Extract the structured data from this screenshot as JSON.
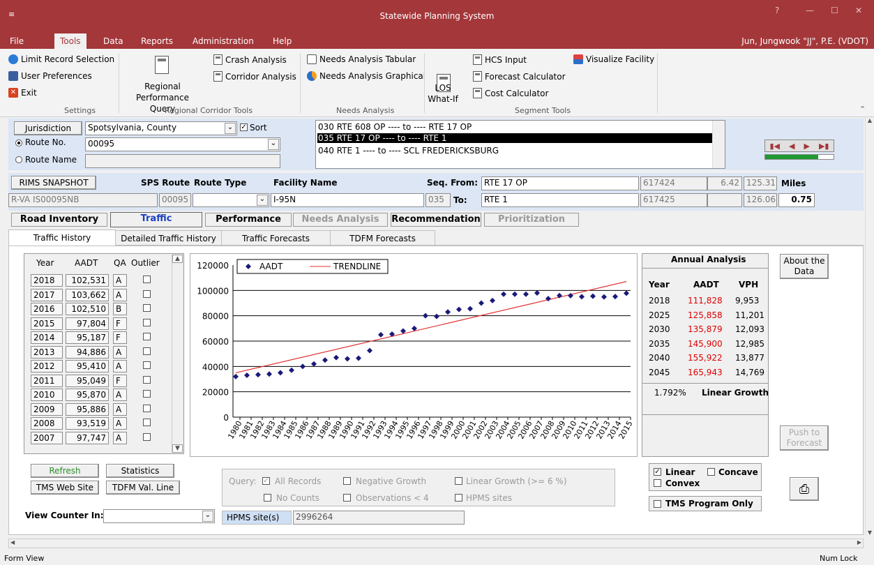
{
  "window": {
    "title": "Statewide Planning System",
    "qat_icon": "≡"
  },
  "menu": [
    "File",
    "Tools",
    "Data",
    "Reports",
    "Administration",
    "Help"
  ],
  "user": "Jun, Jungwook \"JJ\", P.E. (VDOT)",
  "ribbon": {
    "settings": {
      "items": [
        "Limit Record Selection",
        "User Preferences",
        "Exit"
      ],
      "label": "Settings"
    },
    "regional": {
      "big": "Regional Performance Query",
      "items": [
        "Crash Analysis",
        "Corridor Analysis"
      ],
      "label": "Regional Corridor Tools"
    },
    "needs": {
      "items": [
        "Needs Analysis Tabular",
        "Needs Analysis Graphical"
      ],
      "label": "Needs Analysis"
    },
    "segment": {
      "big": "LOS What-If",
      "items": [
        "HCS Input",
        "Forecast Calculator",
        "Cost Calculator"
      ],
      "label": "Segment Tools"
    },
    "visualize": "Visualize Facility"
  },
  "filter": {
    "jurisdiction_btn": "Jurisdiction",
    "jurisdiction": "Spotsylvania, County",
    "sort": "Sort",
    "route_no": "Route No.",
    "route_no_value": "00095",
    "route_name": "Route Name"
  },
  "segments": [
    "030  RTE 608 OP ---- to ---- RTE 17 OP",
    "035  RTE 17 OP ---- to ---- RTE 1",
    "040  RTE 1 ---- to ---- SCL FREDERICKSBURG"
  ],
  "header_row": {
    "rims": "RIMS SNAPSHOT",
    "sps_route": "SPS Route",
    "route_type": "Route Type",
    "facility_name": "Facility Name",
    "seq_from": "Seq. From:",
    "from_value": "RTE 17 OP",
    "id1": "617424",
    "m1": "6.42",
    "m2": "125.31",
    "miles": "Miles"
  },
  "value_row": {
    "rims_id": "R-VA   IS00095NB",
    "sps": "00095",
    "facility": "I-95N",
    "seq": "035",
    "to": "To:",
    "to_value": "RTE 1",
    "id2": "617425",
    "m3": "126.06",
    "miles_val": "0.75"
  },
  "main_tabs": [
    "Road Inventory",
    "Traffic",
    "Performance",
    "Needs Analysis",
    "Recommendation",
    "Prioritization"
  ],
  "sub_tabs": [
    "Traffic History",
    "Detailed Traffic History",
    "Traffic Forecasts",
    "TDFM Forecasts"
  ],
  "history": {
    "headers": [
      "Year",
      "AADT",
      "QA",
      "Outlier"
    ],
    "rows": [
      [
        "2018",
        "102,531",
        "A"
      ],
      [
        "2017",
        "103,662",
        "A"
      ],
      [
        "2016",
        "102,510",
        "B"
      ],
      [
        "2015",
        "97,804",
        "F"
      ],
      [
        "2014",
        "95,187",
        "F"
      ],
      [
        "2013",
        "94,886",
        "A"
      ],
      [
        "2012",
        "95,410",
        "A"
      ],
      [
        "2011",
        "95,049",
        "F"
      ],
      [
        "2010",
        "95,870",
        "A"
      ],
      [
        "2009",
        "95,886",
        "A"
      ],
      [
        "2008",
        "93,519",
        "A"
      ],
      [
        "2007",
        "97,747",
        "A"
      ]
    ]
  },
  "chart_data": {
    "type": "scatter",
    "legend": [
      "AADT",
      "TRENDLINE"
    ],
    "ylim": [
      0,
      120000
    ],
    "yticks": [
      "120000",
      "100000",
      "80000",
      "60000",
      "40000",
      "20000",
      "0"
    ],
    "x": [
      "1980",
      "1981",
      "1982",
      "1983",
      "1984",
      "1985",
      "1986",
      "1987",
      "1988",
      "1989",
      "1990",
      "1991",
      "1992",
      "1993",
      "1994",
      "1995",
      "1996",
      "1997",
      "1998",
      "1999",
      "2000",
      "2001",
      "2002",
      "2003",
      "2004",
      "2005",
      "2006",
      "2007",
      "2008",
      "2009",
      "2010",
      "2011",
      "2012",
      "2013",
      "2014",
      "2015"
    ],
    "values": [
      32000,
      33000,
      33500,
      34000,
      35000,
      37000,
      40000,
      42000,
      45000,
      47000,
      46000,
      46500,
      52500,
      65000,
      65500,
      68000,
      70000,
      80000,
      79500,
      83000,
      85000,
      85500,
      90000,
      92000,
      97000,
      97000,
      97000,
      98000,
      93500,
      95886,
      95870,
      95049,
      95410,
      94886,
      95187,
      97804
    ],
    "trend": [
      35000,
      107000
    ],
    "series_colors": {
      "AADT": "#1a1a7a",
      "TRENDLINE": "#e03030"
    }
  },
  "annual": {
    "title": "Annual Analysis",
    "headers": [
      "Year",
      "AADT",
      "VPH"
    ],
    "rows": [
      [
        "2018",
        "111,828",
        "9,953"
      ],
      [
        "2025",
        "125,858",
        "11,201"
      ],
      [
        "2030",
        "135,879",
        "12,093"
      ],
      [
        "2035",
        "145,900",
        "12,985"
      ],
      [
        "2040",
        "155,922",
        "13,877"
      ],
      [
        "2045",
        "165,943",
        "14,769"
      ]
    ],
    "rate": "1.792%",
    "growth": "Linear Growth"
  },
  "right_buttons": {
    "about": "About the Data",
    "push": "Push to Forecast"
  },
  "buttons": {
    "refresh": "Refresh",
    "statistics": "Statistics",
    "tms": "TMS Web Site",
    "tdfm": "TDFM Val. Line"
  },
  "view_counter": "View Counter In:",
  "query": {
    "label": "Query:",
    "all": "All Records",
    "neg": "Negative Growth",
    "lin": "Linear Growth (>= 6 %)",
    "nocount": "No Counts",
    "obs": "Observations < 4",
    "hpms": "HPMS sites"
  },
  "hpms": {
    "label": "HPMS site(s)",
    "value": "2996264"
  },
  "curve": {
    "linear": "Linear",
    "concave": "Concave",
    "convex": "Convex",
    "tms_only": "TMS Program Only"
  },
  "status": {
    "left": "Form View",
    "right": "Num Lock"
  }
}
